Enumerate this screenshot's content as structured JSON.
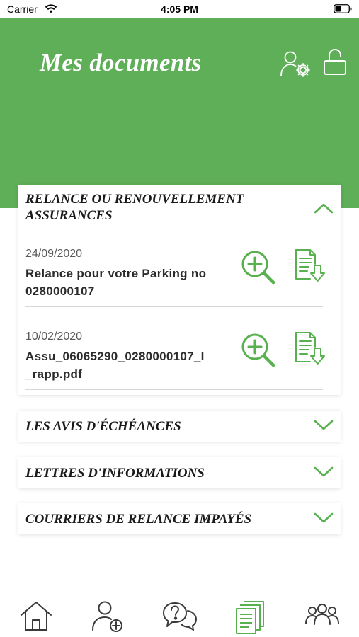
{
  "status_bar": {
    "carrier": "Carrier",
    "time": "4:05 PM"
  },
  "header": {
    "title": "Mes documents"
  },
  "colors": {
    "brand_green": "#5fae58",
    "icon_green": "#58b04f",
    "text_dark": "#1a1a1a"
  },
  "sections": [
    {
      "title_line1": "RELANCE OU RENOUVELLEMENT",
      "title_line2": "ASSURANCES",
      "expanded": true,
      "documents": [
        {
          "date": "24/09/2020",
          "name_line1": "Relance pour votre Parking no",
          "name_line2": "0280000107"
        },
        {
          "date": "10/02/2020",
          "name_line1": "Assu_06065290_0280000107_I",
          "name_line2": "_rapp.pdf"
        }
      ]
    },
    {
      "title": "LES AVIS D'ÉCHÉANCES",
      "expanded": false
    },
    {
      "title": "LETTRES D'INFORMATIONS",
      "expanded": false
    },
    {
      "title": "COURRIERS DE RELANCE IMPAYÉS",
      "expanded": false
    }
  ],
  "icons": {
    "header": [
      "profile-settings-icon",
      "lock-icon"
    ],
    "document_actions": [
      "zoom-in-icon",
      "download-document-icon"
    ],
    "tab_bar": [
      "home-icon",
      "add-user-icon",
      "help-chat-icon",
      "documents-icon",
      "group-icon"
    ]
  },
  "tab_bar": {
    "active_tab": "documents"
  }
}
